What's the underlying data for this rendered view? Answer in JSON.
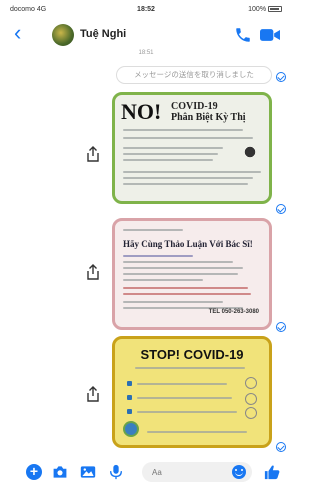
{
  "status_bar": {
    "carrier": "docomo 4G",
    "time": "18:52",
    "right": "100%"
  },
  "header": {
    "contact_name": "Tuệ Nghi"
  },
  "chat": {
    "timestamp": "18:51",
    "unsent_notice": "メッセージの送信を取り消しました",
    "cards": [
      {
        "title": "NO!",
        "subtitle_line1": "COVID-19",
        "subtitle_line2": "Phân Biệt Kỳ Thị"
      },
      {
        "title": "Hãy Cùng Thảo Luận Với Bác Sĩ!",
        "phone": "TEL 050-263-3080"
      },
      {
        "title": "STOP! COVID-19"
      }
    ]
  },
  "composer": {
    "placeholder": "Aa"
  },
  "colors": {
    "accent": "#1877f2",
    "card1_border": "#7fb34a",
    "card2_border": "#d9a3a8",
    "card3_border": "#c9a21a"
  }
}
